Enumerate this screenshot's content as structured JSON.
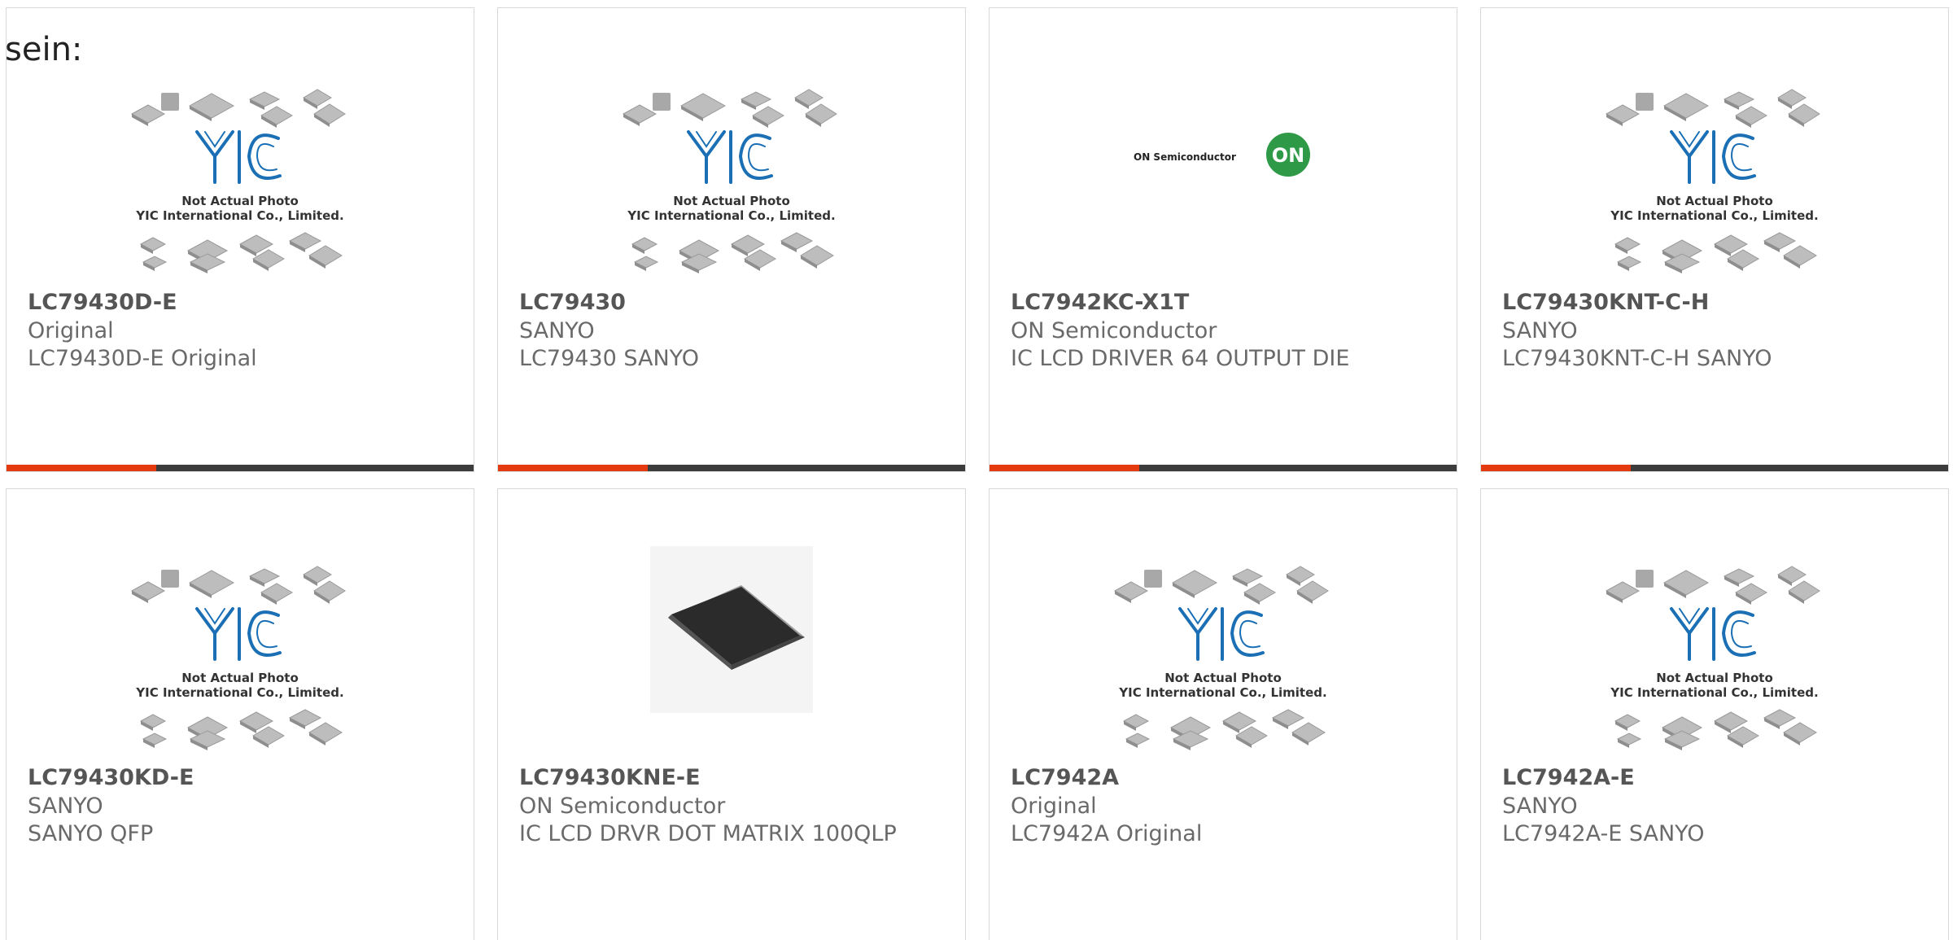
{
  "intro_text": "sein:",
  "placeholder_text": {
    "line1": "Not Actual Photo",
    "line2": "YIC International Co., Limited."
  },
  "on_logo_text": "ON Semiconductor",
  "on_logo_badge": "ON",
  "colors": {
    "accent": "#e43a0f",
    "bar": "#3c3c3c",
    "yic_blue": "#1a6fb5"
  },
  "products": [
    {
      "name": "LC79430D-E",
      "line1": "Original",
      "line2": "LC79430D-E Original",
      "image": "yic-placeholder"
    },
    {
      "name": "LC79430",
      "line1": "SANYO",
      "line2": "LC79430 SANYO",
      "image": "yic-placeholder"
    },
    {
      "name": "LC7942KC-X1T",
      "line1": "ON Semiconductor",
      "line2": "IC LCD DRIVER 64 OUTPUT DIE",
      "image": "on-semiconductor-logo"
    },
    {
      "name": "LC79430KNT-C-H",
      "line1": "SANYO",
      "line2": "LC79430KNT-C-H SANYO",
      "image": "yic-placeholder"
    },
    {
      "name": "LC79430KD-E",
      "line1": "SANYO",
      "line2": "SANYO QFP",
      "image": "yic-placeholder"
    },
    {
      "name": "LC79430KNE-E",
      "line1": "ON Semiconductor",
      "line2": "IC LCD DRVR DOT MATRIX 100QLP",
      "image": "qfp-chip-photo"
    },
    {
      "name": "LC7942A",
      "line1": "Original",
      "line2": "LC7942A Original",
      "image": "yic-placeholder"
    },
    {
      "name": "LC7942A-E",
      "line1": "SANYO",
      "line2": "LC7942A-E SANYO",
      "image": "yic-placeholder"
    }
  ]
}
